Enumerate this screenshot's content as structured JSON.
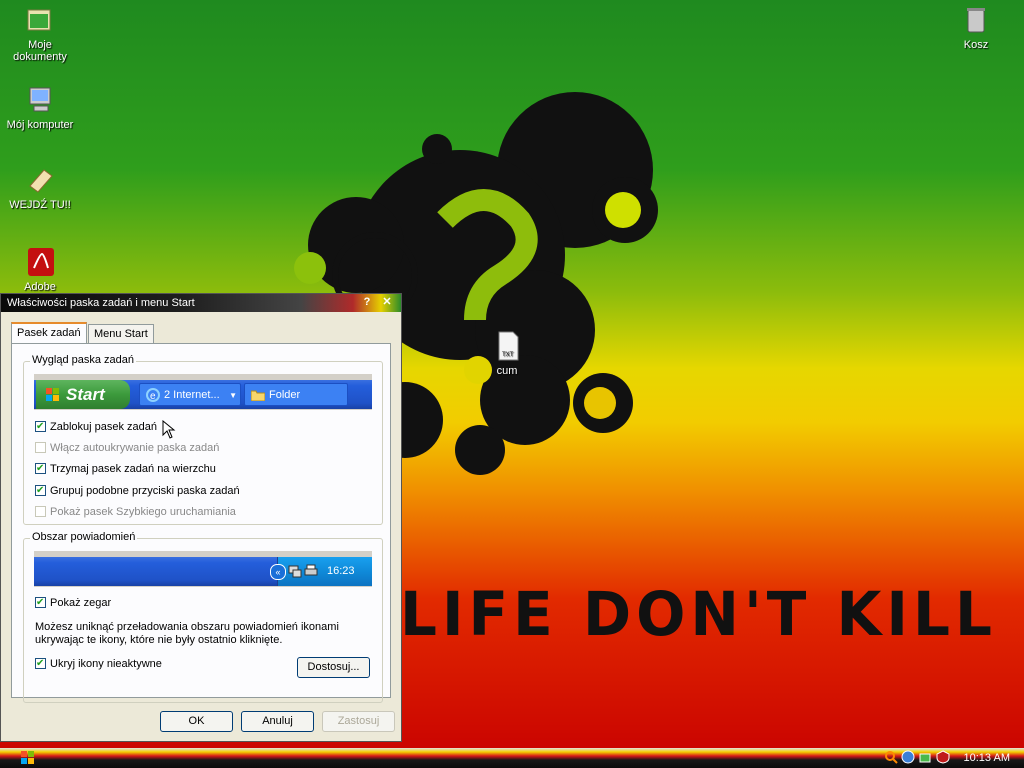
{
  "desktop": {
    "icons": [
      {
        "label": "Moje\ndokumenty",
        "icon": "my-documents-icon"
      },
      {
        "label": "Mój komputer",
        "icon": "my-computer-icon"
      },
      {
        "label": "WEJDŹ TU!!",
        "icon": "scroll-icon"
      },
      {
        "label": "Adobe",
        "icon": "adobe-reader-icon"
      },
      {
        "label": "Kosz",
        "icon": "recycle-bin-icon"
      },
      {
        "label": "cum",
        "icon": "text-file-icon"
      }
    ],
    "wallpaper_text": "LIFE DON'T KILL"
  },
  "dialog": {
    "title": "Właściwości paska zadań i menu Start",
    "help_button": "?",
    "close_button": "✕",
    "tabs": [
      {
        "label": "Pasek zadań",
        "active": true
      },
      {
        "label": "Menu Start",
        "active": false
      }
    ],
    "appearance_group": {
      "legend": "Wygląd paska zadań",
      "preview": {
        "start_label": "Start",
        "task_buttons": [
          {
            "label": "2 Internet...",
            "icon": "internet-explorer-icon"
          },
          {
            "label": "Folder",
            "icon": "folder-icon"
          }
        ]
      },
      "options": [
        {
          "label": "Zablokuj pasek zadań",
          "checked": true,
          "enabled": true
        },
        {
          "label": "Włącz autoukrywanie paska zadań",
          "checked": false,
          "enabled": false
        },
        {
          "label": "Trzymaj pasek zadań na wierzchu",
          "checked": true,
          "enabled": true
        },
        {
          "label": "Grupuj podobne przyciski paska zadań",
          "checked": true,
          "enabled": true
        },
        {
          "label": "Pokaż pasek Szybkiego uruchamiania",
          "checked": false,
          "enabled": false
        }
      ]
    },
    "notification_group": {
      "legend": "Obszar powiadomień",
      "preview_time": "16:23",
      "show_clock": {
        "label": "Pokaż zegar",
        "checked": true
      },
      "description": "Możesz uniknąć przeładowania obszaru powiadomień ikonami ukrywając te ikony, które nie były ostatnio kliknięte.",
      "hide_inactive": {
        "label": "Ukryj ikony nieaktywne",
        "checked": true
      },
      "customize_button": "Dostosuj..."
    },
    "buttons": {
      "ok": "OK",
      "cancel": "Anuluj",
      "apply": "Zastosuj"
    }
  },
  "taskbar": {
    "clock": "10:13 AM"
  },
  "colors": {
    "xp_blue": "#245edb",
    "start_green": "#3c9a3c",
    "dialog_bg": "#ece9d8"
  }
}
